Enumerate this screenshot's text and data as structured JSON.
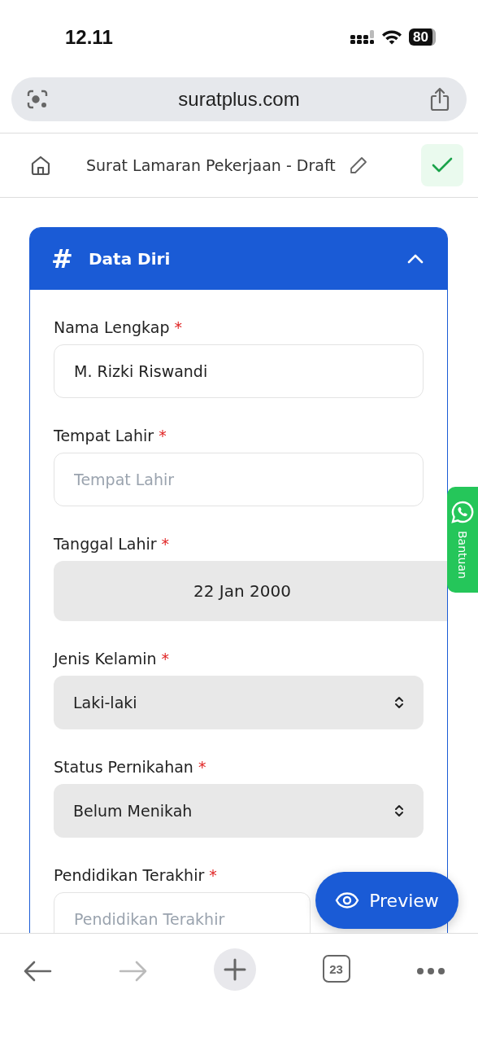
{
  "status_bar": {
    "time": "12.11",
    "battery": "80"
  },
  "browser": {
    "url": "suratplus.com",
    "tab_count": "23"
  },
  "header": {
    "title": "Surat Lamaran Pekerjaan - Draft"
  },
  "section": {
    "icon": "#",
    "title": "Data Diri",
    "expanded": true,
    "fields": [
      {
        "kind": "text",
        "label": "Nama Lengkap",
        "required": "*",
        "value": "M. Rizki Riswandi"
      },
      {
        "kind": "text",
        "label": "Tempat Lahir",
        "required": "*",
        "placeholder": "Tempat Lahir"
      },
      {
        "kind": "date",
        "label": "Tanggal Lahir",
        "required": "*",
        "value": "22 Jan 2000"
      },
      {
        "kind": "select",
        "label": "Jenis Kelamin",
        "required": "*",
        "value": "Laki-laki"
      },
      {
        "kind": "select",
        "label": "Status Pernikahan",
        "required": "*",
        "value": "Belum Menikah"
      },
      {
        "kind": "text",
        "label": "Pendidikan Terakhir",
        "required": "*",
        "placeholder": "Pendidikan Terakhir"
      }
    ]
  },
  "help_tab": {
    "label": "Bantuan"
  },
  "preview_button": {
    "label": "Preview"
  }
}
